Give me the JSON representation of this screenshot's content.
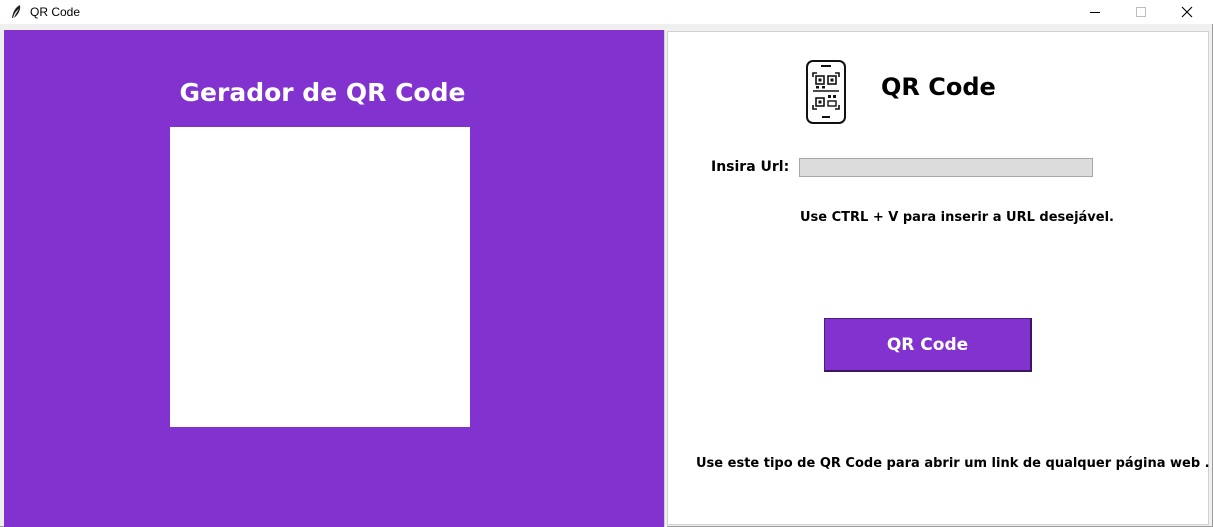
{
  "window": {
    "title": "QR Code",
    "icon": "feather-icon",
    "controls": [
      "minimize-icon",
      "maximize-icon",
      "close-icon"
    ]
  },
  "left_panel": {
    "title": "Gerador de QR Code",
    "background_color": "#8132cf",
    "qr_area_color": "#ffffff"
  },
  "right_panel": {
    "icon": "phone-qr-icon",
    "title": "QR Code",
    "url_label": "Insira Url:",
    "url_value": "",
    "hint": "Use CTRL + V para inserir a URL desejável.",
    "button_label": "QR Code",
    "button_color": "#8132cf",
    "footer": "Use este tipo de QR Code para abrir um link de qualquer página web ."
  }
}
